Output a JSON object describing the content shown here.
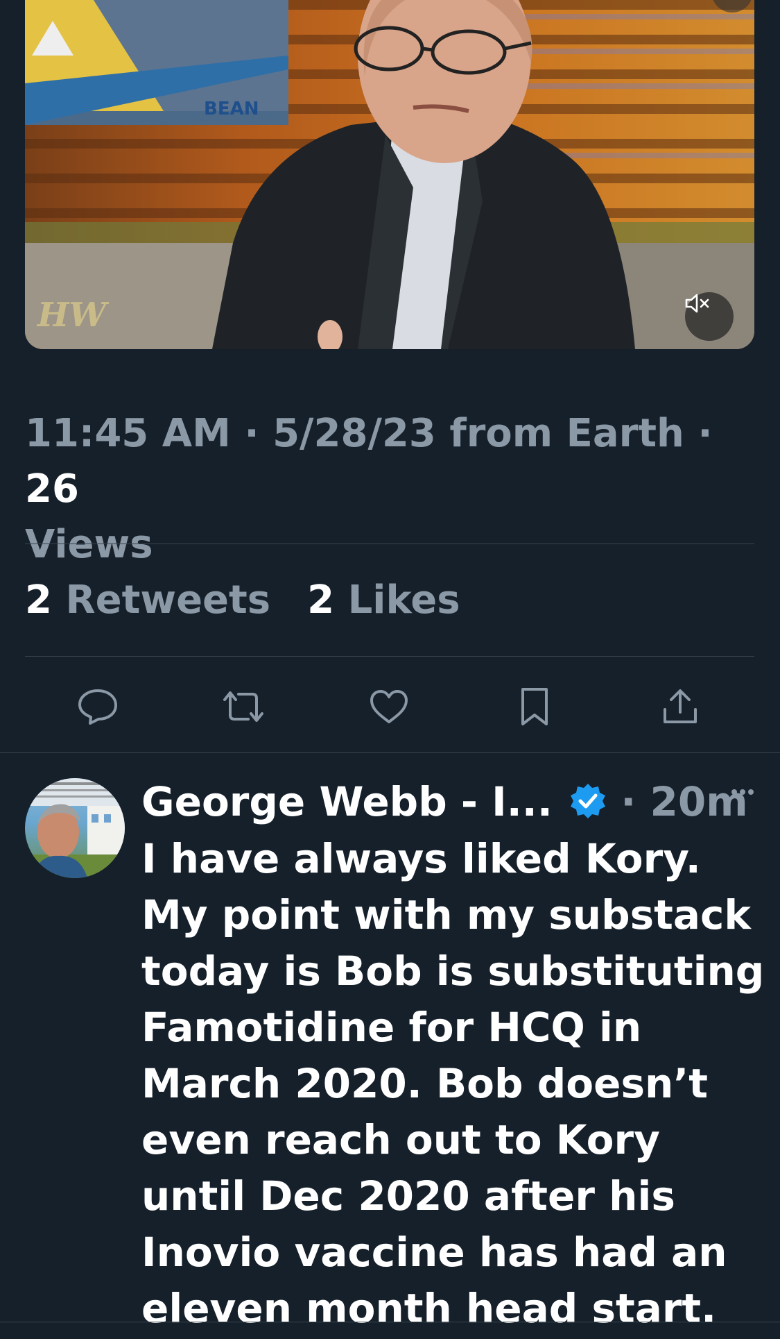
{
  "video": {
    "mute_icon": "speaker-muted-icon",
    "watermark": "HW",
    "screen_text": "BEAN"
  },
  "tweet_meta": {
    "time": "11:45 AM",
    "sep1": " · ",
    "date": "5/28/23",
    "source": " from Earth",
    "sep2": " · ",
    "views_count": "26",
    "views_label": "Views"
  },
  "stats": {
    "retweets_count": "2",
    "retweets_label": "Retweets",
    "likes_count": "2",
    "likes_label": "Likes"
  },
  "actions": {
    "icons": [
      "reply-icon",
      "retweet-icon",
      "like-icon",
      "bookmark-icon",
      "share-icon"
    ],
    "icon_color": "#8b98a5"
  },
  "reply": {
    "author": "George Webb - I...",
    "verified_icon": "verified-badge-icon",
    "verified_color": "#1d9bf0",
    "separator": " · ",
    "time": "20m",
    "more_icon": "more-icon",
    "text": "I have always liked Kory. My point with my substack today is Bob is substituting Famotidine for HCQ in March 2020. Bob doesn’t even reach out to Kory until Dec 2020 after his Inovio vaccine has had an eleven month head start."
  },
  "colors": {
    "background": "#15202b",
    "secondary_text": "#8b98a5",
    "divider": "#38444d",
    "accent": "#1d9bf0"
  }
}
